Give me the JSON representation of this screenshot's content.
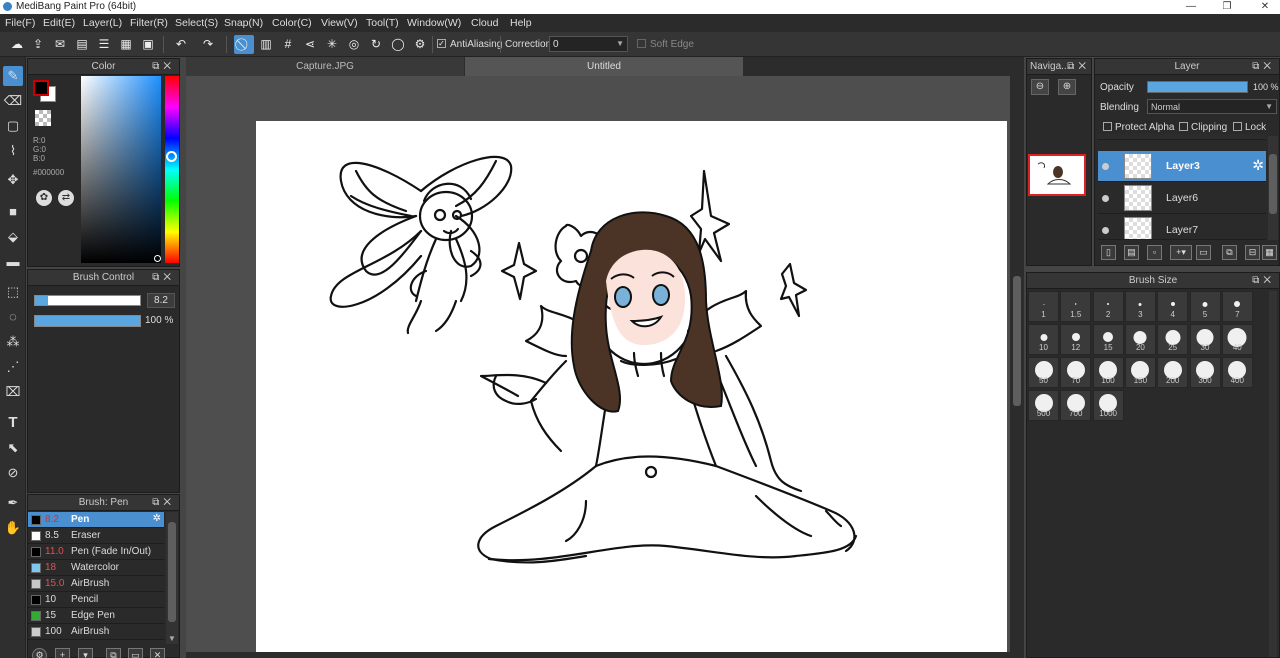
{
  "window": {
    "title": "MediBang Paint Pro (64bit)",
    "minimize": "—",
    "maximize": "❐",
    "close": "✕"
  },
  "menu": [
    "File(F)",
    "Edit(E)",
    "Layer(L)",
    "Filter(R)",
    "Select(S)",
    "Snap(N)",
    "Color(C)",
    "View(V)",
    "Tool(T)",
    "Window(W)",
    "Cloud",
    "Help"
  ],
  "toolbar": {
    "antialias_label": "AntiAliasing",
    "correction_label": "Correction",
    "correction_value": "0",
    "softedge_label": "Soft Edge"
  },
  "color_panel": {
    "title": "Color",
    "r": "R:0",
    "g": "G:0",
    "b": "B:0",
    "hex": "#000000",
    "foreground": "#000000",
    "background": "#ffffff"
  },
  "brush_control": {
    "title": "Brush Control",
    "size": "8.2",
    "size_fraction": 0.12,
    "opacity": "100 %",
    "opacity_fraction": 1.0
  },
  "brush_list": {
    "title": "Brush: Pen",
    "items": [
      {
        "size": "8.2",
        "name": "Pen",
        "color": "#000000",
        "selected": true
      },
      {
        "size": "8.5",
        "name": "Eraser",
        "color": "#ffffff"
      },
      {
        "size": "11.0",
        "name": "Pen (Fade In/Out)",
        "color": "#000000"
      },
      {
        "size": "18",
        "name": "Watercolor",
        "color": "#7ec8f0"
      },
      {
        "size": "15.0",
        "name": "AirBrush",
        "color": "#c8c8c8"
      },
      {
        "size": "10",
        "name": "Pencil",
        "color": "#000000"
      },
      {
        "size": "15",
        "name": "Edge Pen",
        "color": "#33aa33"
      },
      {
        "size": "100",
        "name": "AirBrush",
        "color": "#cccccc"
      }
    ]
  },
  "document_tabs": [
    "Capture.JPG",
    "Untitled"
  ],
  "navigator": {
    "title": "Naviga..."
  },
  "layer_panel": {
    "title": "Layer",
    "opacity_label": "Opacity",
    "opacity_value": "100 %",
    "blending_label": "Blending",
    "blending_value": "Normal",
    "protect_alpha": "Protect Alpha",
    "clipping": "Clipping",
    "lock": "Lock",
    "layers": [
      {
        "name": "Layer3",
        "selected": true
      },
      {
        "name": "Layer6",
        "selected": false
      },
      {
        "name": "Layer7",
        "selected": false
      }
    ]
  },
  "brush_size_panel": {
    "title": "Brush Size",
    "sizes": [
      "1",
      "1.5",
      "2",
      "3",
      "4",
      "5",
      "7",
      "10",
      "12",
      "15",
      "20",
      "25",
      "30",
      "40",
      "50",
      "70",
      "100",
      "150",
      "200",
      "300",
      "400",
      "500",
      "700",
      "1000"
    ]
  }
}
